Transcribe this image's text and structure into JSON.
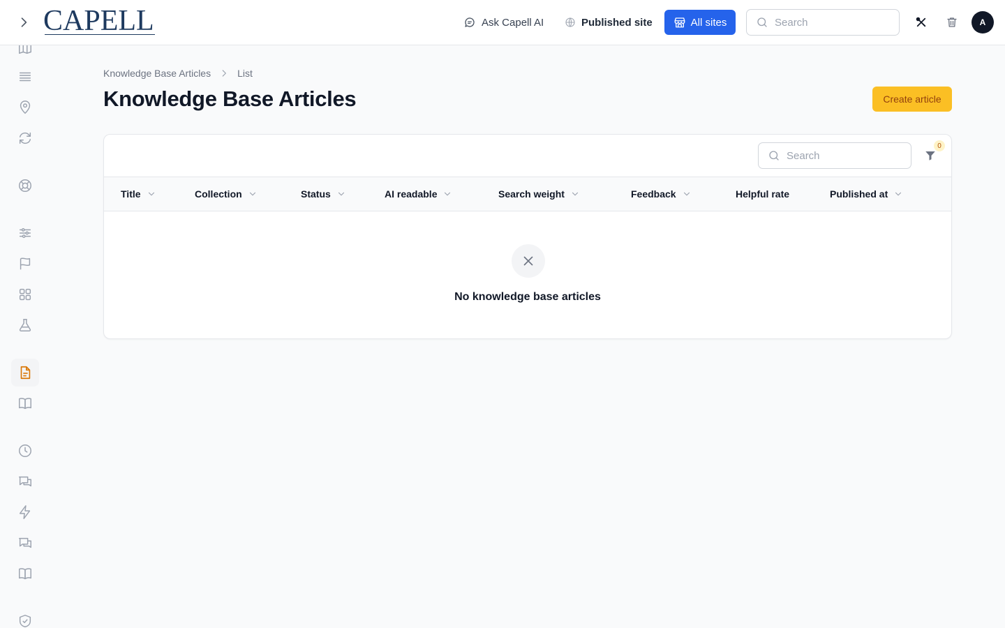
{
  "brand": {
    "name": "CAPELL"
  },
  "topbar": {
    "ask_ai_label": "Ask Capell AI",
    "published_site_label": "Published site",
    "all_sites_label": "All sites",
    "search_placeholder": "Search",
    "avatar_initial": "A"
  },
  "breadcrumb": {
    "items": [
      "Knowledge Base Articles",
      "List"
    ]
  },
  "page": {
    "title": "Knowledge Base Articles",
    "create_label": "Create article"
  },
  "table": {
    "search_placeholder": "Search",
    "filter_count": "0",
    "columns": [
      "Title",
      "Collection",
      "Status",
      "AI readable",
      "Search weight",
      "Feedback",
      "Helpful rate",
      "Published at"
    ],
    "rows": [],
    "empty_text": "No knowledge base articles"
  },
  "sidebar": {
    "icons": [
      "map-icon",
      "list-icon",
      "location-pin-icon",
      "refresh-icon",
      "lifebuoy-icon",
      "sliders-icon",
      "flag-icon",
      "grid-icon",
      "flask-icon",
      "document-icon",
      "book-open-icon",
      "clock-icon",
      "chat-bubbles-icon",
      "lightning-icon",
      "chat-bubbles-icon",
      "book-open-icon",
      "shield-check-icon"
    ],
    "active": "document-icon"
  },
  "colors": {
    "primary_blue": "#2563eb",
    "accent_amber": "#fbbf24",
    "accent_text": "#92400e",
    "active_icon": "#d97706"
  }
}
